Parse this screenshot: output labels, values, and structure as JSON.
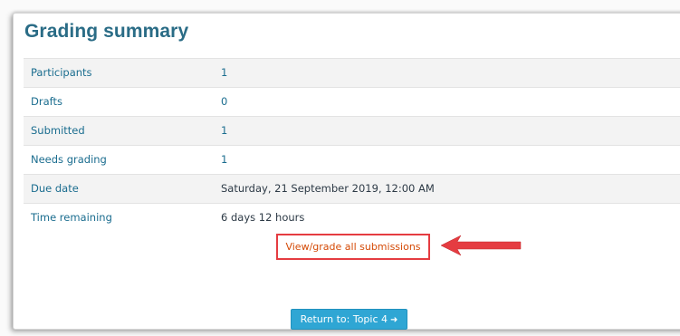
{
  "page": {
    "title": "Grading summary"
  },
  "summary": {
    "rows": [
      {
        "label": "Participants",
        "value": "1"
      },
      {
        "label": "Drafts",
        "value": "0"
      },
      {
        "label": "Submitted",
        "value": "1"
      },
      {
        "label": "Needs grading",
        "value": "1"
      },
      {
        "label": "Due date",
        "value": "Saturday, 21 September 2019, 12:00 AM"
      },
      {
        "label": "Time remaining",
        "value": "6 days 12 hours"
      }
    ]
  },
  "actions": {
    "view_grade_label": "View/grade all submissions",
    "return_label": "Return to: Topic 4",
    "return_icon": "arrow-right-icon"
  },
  "colors": {
    "title": "#2a6c86",
    "link": "#1b6d8f",
    "highlight_border": "#e53c41",
    "button": "#2fa6d4"
  }
}
